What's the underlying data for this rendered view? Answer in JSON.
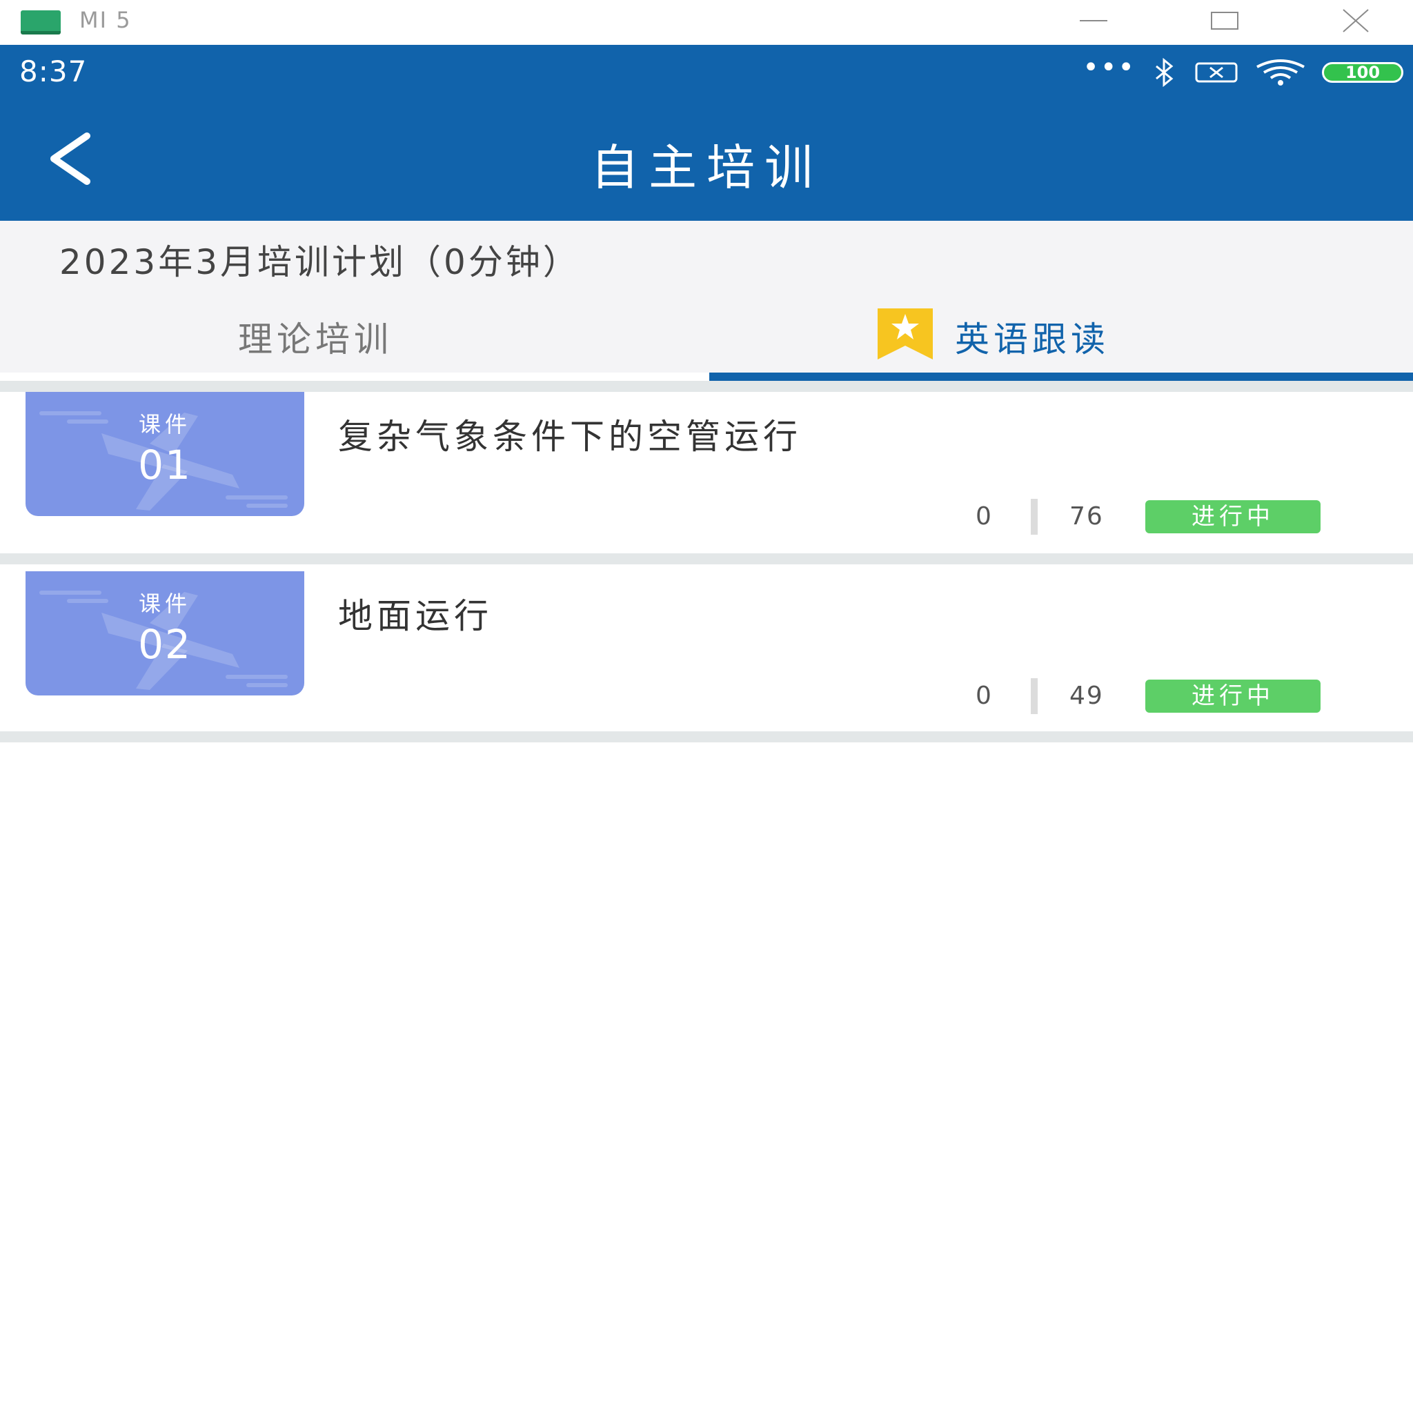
{
  "window": {
    "device_name": "MI 5"
  },
  "status_bar": {
    "time": "8:37",
    "dots": "•••",
    "battery": "100"
  },
  "header": {
    "title": "自主培训"
  },
  "plan": {
    "title": "2023年3月培训计划（0分钟）"
  },
  "tabs": [
    {
      "label": "理论培训",
      "active": false
    },
    {
      "label": "英语跟读",
      "active": true,
      "icon": "star-bookmark-icon"
    }
  ],
  "courses": [
    {
      "thumb_label": "课件",
      "thumb_num": "01",
      "title": "复杂气象条件下的空管运行",
      "stat_a": "0",
      "stat_b": "76",
      "status": "进行中"
    },
    {
      "thumb_label": "课件",
      "thumb_num": "02",
      "title": "地面运行",
      "stat_a": "0",
      "stat_b": "49",
      "status": "进行中"
    }
  ],
  "colors": {
    "primary": "#1163ab",
    "thumb": "#7d95e6",
    "badge": "#5dcf67",
    "tab_icon": "#f7c520"
  }
}
